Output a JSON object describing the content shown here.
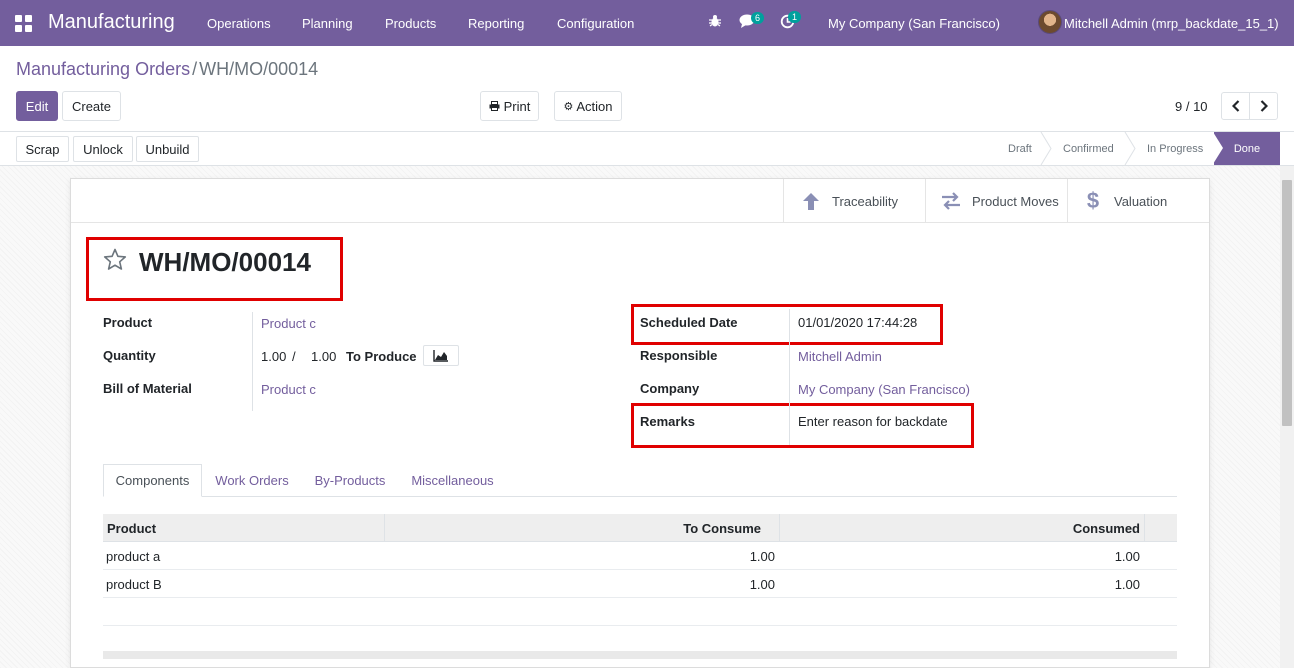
{
  "navbar": {
    "brand": "Manufacturing",
    "menu": [
      "Operations",
      "Planning",
      "Products",
      "Reporting",
      "Configuration"
    ],
    "messages_count": "6",
    "activities_count": "1",
    "company": "My Company (San Francisco)",
    "user": "Mitchell Admin (mrp_backdate_15_1)"
  },
  "breadcrumb": {
    "parent": "Manufacturing Orders",
    "separator": "/",
    "current": "WH/MO/00014"
  },
  "control_panel": {
    "edit_label": "Edit",
    "create_label": "Create",
    "print_label": "Print",
    "action_label": "Action",
    "pager": "9 / 10"
  },
  "statusbar": {
    "buttons": [
      "Scrap",
      "Unlock",
      "Unbuild"
    ],
    "stages": [
      "Draft",
      "Confirmed",
      "In Progress",
      "Done"
    ],
    "current_stage": "Done"
  },
  "smart_buttons": [
    "Traceability",
    "Product Moves",
    "Valuation"
  ],
  "record": {
    "name": "WH/MO/00014",
    "left_fields": {
      "product_label": "Product",
      "product_value": "Product c",
      "quantity_label": "Quantity",
      "qty_produced": "1.00",
      "qty_sep": "/",
      "qty_total": "1.00",
      "to_produce_label": "To Produce",
      "bom_label": "Bill of Material",
      "bom_value": "Product c"
    },
    "right_fields": {
      "scheduled_date_label": "Scheduled Date",
      "scheduled_date_value": "01/01/2020 17:44:28",
      "responsible_label": "Responsible",
      "responsible_value": "Mitchell Admin",
      "company_label": "Company",
      "company_value": "My Company (San Francisco)",
      "remarks_label": "Remarks",
      "remarks_value": "Enter reason for backdate"
    }
  },
  "tabs": [
    "Components",
    "Work Orders",
    "By-Products",
    "Miscellaneous"
  ],
  "active_tab": "Components",
  "components_table": {
    "headers": [
      "Product",
      "To Consume",
      "Consumed"
    ],
    "rows": [
      {
        "product": "product a",
        "to_consume": "1.00",
        "consumed": "1.00"
      },
      {
        "product": "product B",
        "to_consume": "1.00",
        "consumed": "1.00"
      }
    ]
  },
  "colors": {
    "brand": "#735e9d",
    "highlight": "#e00000"
  }
}
